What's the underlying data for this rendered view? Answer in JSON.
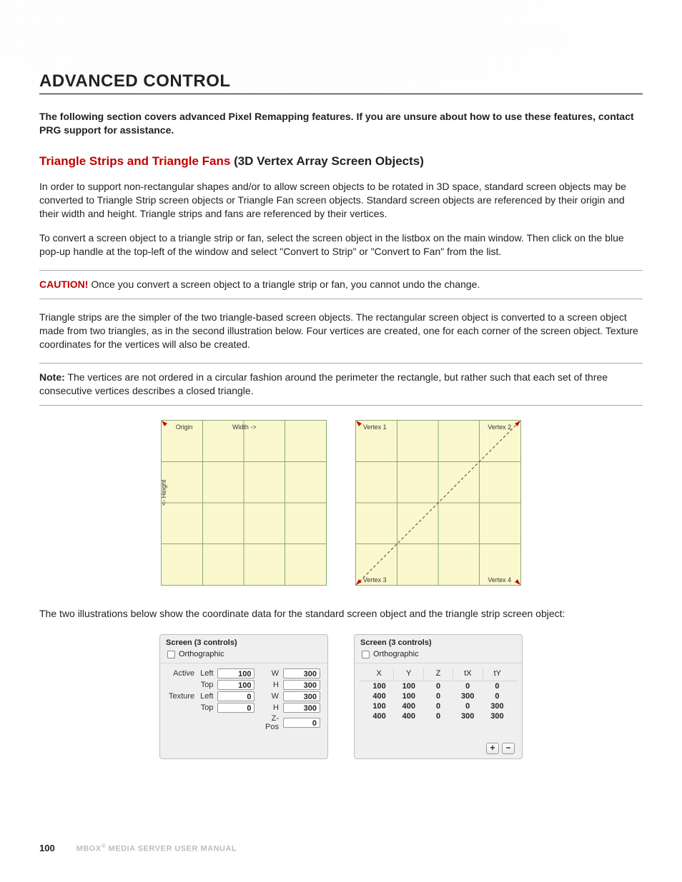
{
  "heading": "ADVANCED CONTROL",
  "intro": "The following section covers advanced Pixel Remapping features. If you are unsure about how to use these features, contact PRG support for assistance.",
  "subhead_red": "Triangle Strips and Triangle Fans",
  "subhead_rest": " (3D Vertex Array Screen Objects)",
  "p1": "In order to support non-rectangular shapes and/or to allow screen objects to be rotated in 3D space, standard screen objects may be converted to Triangle Strip screen objects or Triangle Fan screen objects. Standard screen objects are referenced by their origin and their width and height. Triangle strips and fans are referenced by their vertices.",
  "p2": "To convert a screen object to a triangle strip or fan, select the screen object in the listbox on the main window. Then click on the blue pop-up handle at the top-left of the window and select \"Convert to Strip\" or \"Convert to Fan\" from the list.",
  "caution_word": "CAUTION!",
  "caution_text": "  Once you convert a screen object to a triangle strip or fan, you cannot undo the change.",
  "p3": "Triangle strips are the simpler of the two triangle-based screen objects. The rectangular screen object is converted to a screen object made from two triangles, as in the second illustration below. Four vertices are created, one for each corner of the screen object. Texture coordinates for the vertices will also be created.",
  "note_word": "Note:",
  "note_text": "  The vertices are not ordered in a circular fashion around the perimeter the rectangle, but rather such that each set of three consecutive vertices describes a closed triangle.",
  "diag1": {
    "origin": "Origin",
    "width": "Width ->",
    "height": "<- Height"
  },
  "diag2": {
    "v1": "Vertex 1",
    "v2": "Vertex 2",
    "v3": "Vertex 3",
    "v4": "Vertex 4"
  },
  "p4": "The two illustrations below show the coordinate data for the standard screen object and the triangle strip screen object:",
  "panelA": {
    "title": "Screen (3 controls)",
    "ortho": "Orthographic",
    "rows": [
      {
        "lab1": "Active",
        "lab2": "Left",
        "v1": "100",
        "lab3": "W",
        "v2": "300"
      },
      {
        "lab1": "",
        "lab2": "Top",
        "v1": "100",
        "lab3": "H",
        "v2": "300"
      },
      {
        "lab1": "Texture",
        "lab2": "Left",
        "v1": "0",
        "lab3": "W",
        "v2": "300"
      },
      {
        "lab1": "",
        "lab2": "Top",
        "v1": "0",
        "lab3": "H",
        "v2": "300"
      },
      {
        "lab1": "",
        "lab2": "",
        "v1": "",
        "lab3": "Z-Pos",
        "v2": "0"
      }
    ]
  },
  "panelB": {
    "title": "Screen (3 controls)",
    "ortho": "Orthographic",
    "headers": [
      "X",
      "Y",
      "Z",
      "tX",
      "tY"
    ],
    "rows": [
      [
        "100",
        "100",
        "0",
        "0",
        "0"
      ],
      [
        "400",
        "100",
        "0",
        "300",
        "0"
      ],
      [
        "100",
        "400",
        "0",
        "0",
        "300"
      ],
      [
        "400",
        "400",
        "0",
        "300",
        "300"
      ]
    ],
    "plus": "+",
    "minus": "−"
  },
  "footer": {
    "page": "100",
    "pub_a": "MBOX",
    "pub_b": " MEDIA SERVER USER MANUAL"
  },
  "chart_data": {
    "type": "table",
    "title": "Triangle strip vertex coordinates",
    "headers": [
      "X",
      "Y",
      "Z",
      "tX",
      "tY"
    ],
    "rows": [
      [
        100,
        100,
        0,
        0,
        0
      ],
      [
        400,
        100,
        0,
        300,
        0
      ],
      [
        100,
        400,
        0,
        0,
        300
      ],
      [
        400,
        400,
        0,
        300,
        300
      ]
    ]
  }
}
